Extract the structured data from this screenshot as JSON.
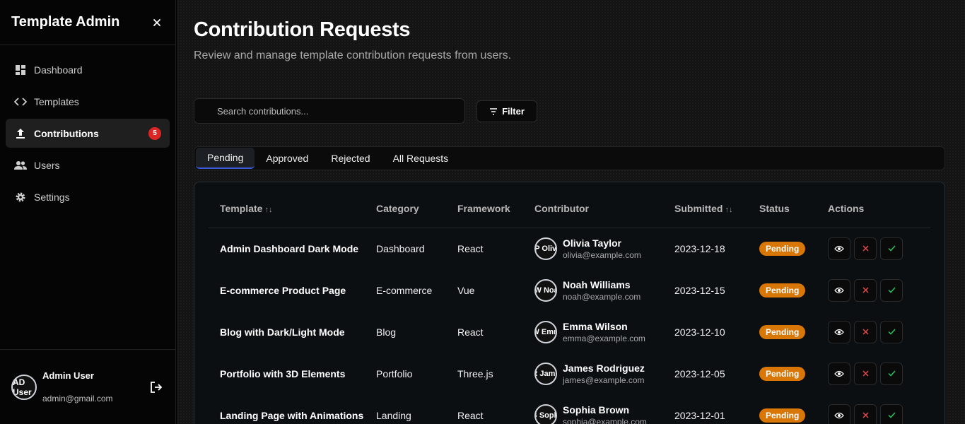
{
  "app": {
    "title": "Template Admin"
  },
  "nav": [
    {
      "label": "Dashboard",
      "icon": "dashboard-icon"
    },
    {
      "label": "Templates",
      "icon": "code-icon"
    },
    {
      "label": "Contributions",
      "icon": "upload-icon",
      "badge": "5",
      "active": true
    },
    {
      "label": "Users",
      "icon": "users-icon"
    },
    {
      "label": "Settings",
      "icon": "gear-icon"
    }
  ],
  "user": {
    "name": "Admin User",
    "email": "admin@gmail.com",
    "initials": "AD User"
  },
  "page": {
    "title": "Contribution Requests",
    "subtitle": "Review and manage template contribution requests from users."
  },
  "search": {
    "placeholder": "Search contributions..."
  },
  "filter": {
    "label": "Filter"
  },
  "tabs": [
    "Pending",
    "Approved",
    "Rejected",
    "All Requests"
  ],
  "table": {
    "headers": {
      "template": "Template",
      "category": "Category",
      "framework": "Framework",
      "contributor": "Contributor",
      "submitted": "Submitted",
      "status": "Status",
      "actions": "Actions"
    },
    "sort_glyph": "↑↓",
    "rows": [
      {
        "template": "Admin Dashboard Dark Mode",
        "category": "Dashboard",
        "framework": "React",
        "name": "Olivia Taylor",
        "email": "olivia@example.com",
        "initials": "OP Olivia",
        "submitted": "2023-12-18",
        "status": "Pending"
      },
      {
        "template": "E-commerce Product Page",
        "category": "E-commerce",
        "framework": "Vue",
        "name": "Noah Williams",
        "email": "noah@example.com",
        "initials": "NW Noah",
        "submitted": "2023-12-15",
        "status": "Pending"
      },
      {
        "template": "Blog with Dark/Light Mode",
        "category": "Blog",
        "framework": "React",
        "name": "Emma Wilson",
        "email": "emma@example.com",
        "initials": "EW Emma",
        "submitted": "2023-12-10",
        "status": "Pending"
      },
      {
        "template": "Portfolio with 3D Elements",
        "category": "Portfolio",
        "framework": "Three.js",
        "name": "James Rodriguez",
        "email": "james@example.com",
        "initials": "JR James",
        "submitted": "2023-12-05",
        "status": "Pending"
      },
      {
        "template": "Landing Page with Animations",
        "category": "Landing",
        "framework": "React",
        "name": "Sophia Brown",
        "email": "sophia@example.com",
        "initials": "SB Sophia",
        "submitted": "2023-12-01",
        "status": "Pending"
      }
    ]
  },
  "colors": {
    "pending": "#d97706",
    "badge": "#dc2626",
    "reject": "#ef4444",
    "approve": "#22c55e",
    "tab_underline": "#3b5bdb"
  }
}
